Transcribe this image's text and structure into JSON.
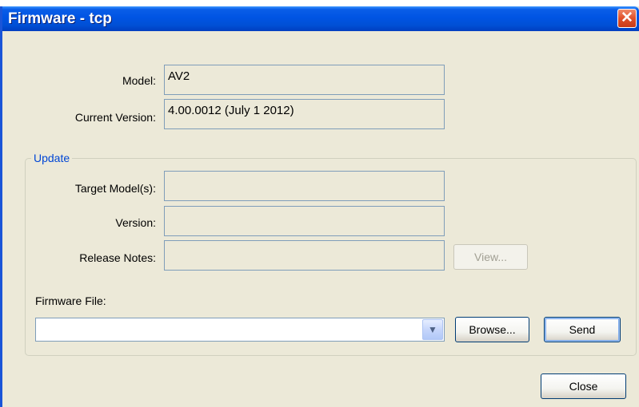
{
  "window": {
    "title": "Firmware - tcp",
    "close_glyph": "✕"
  },
  "device": {
    "model_label": "Model:",
    "model_value": "AV2",
    "current_version_label": "Current Version:",
    "current_version_value": "4.00.0012 (July 1 2012)"
  },
  "update": {
    "group_title": "Update",
    "target_models_label": "Target Model(s):",
    "target_models_value": "",
    "version_label": "Version:",
    "version_value": "",
    "release_notes_label": "Release Notes:",
    "release_notes_value": "",
    "view_button": "View...",
    "firmware_file_label": "Firmware File:",
    "firmware_file_value": "",
    "browse_button": "Browse...",
    "send_button": "Send"
  },
  "footer": {
    "close_button": "Close"
  },
  "icons": {
    "dropdown_arrow": "chevron-down-icon",
    "close": "close-icon"
  },
  "colors": {
    "titlebar": "#0054e3",
    "window_bg": "#ece9d8",
    "group_title": "#0046d5",
    "field_border": "#7f9db9"
  }
}
